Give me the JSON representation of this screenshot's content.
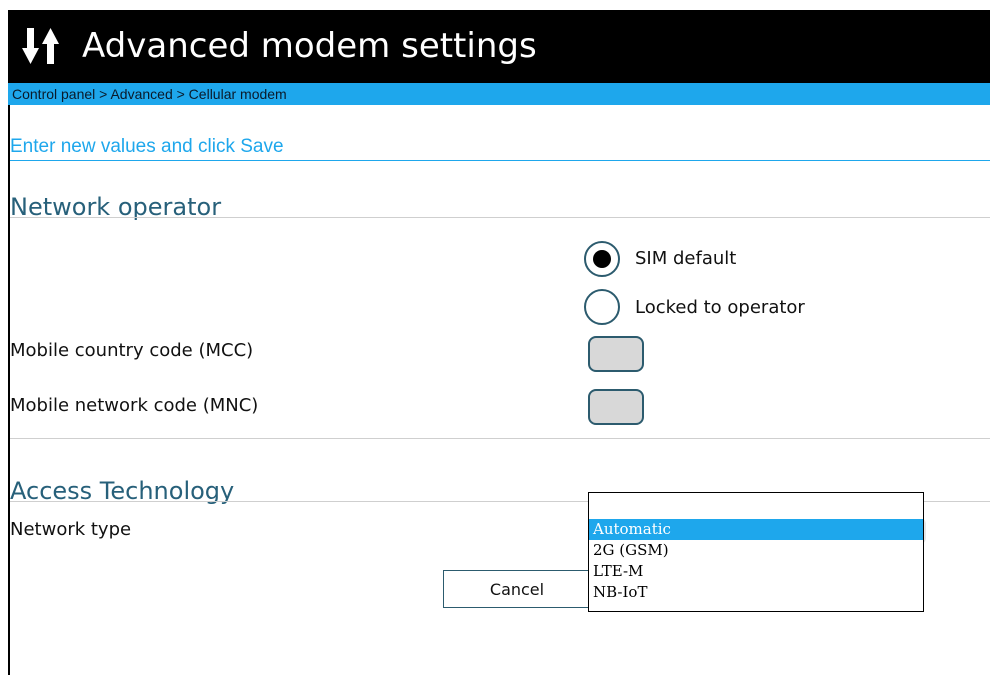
{
  "header": {
    "title": "Advanced modem settings",
    "icon": "up-down-arrows-icon"
  },
  "breadcrumb": {
    "text": "Control panel > Advanced > Cellular modem"
  },
  "instructions": "Enter new values and click Save",
  "network_operator": {
    "title": "Network operator",
    "options": [
      {
        "label": "SIM default",
        "selected": true
      },
      {
        "label": "Locked to operator",
        "selected": false
      }
    ],
    "mcc": {
      "label": "Mobile country code (MCC)",
      "value": ""
    },
    "mnc": {
      "label": "Mobile network code (MNC)",
      "value": ""
    }
  },
  "access_technology": {
    "title": "Access Technology",
    "network_type": {
      "label": "Network type",
      "selected": "Automatic",
      "options": [
        "Automatic",
        "2G (GSM)",
        "LTE-M",
        "NB-IoT"
      ]
    }
  },
  "actions": {
    "cancel_label": "Cancel"
  },
  "colors": {
    "accent": "#1ea7ec",
    "header_bg": "#000000",
    "section_title": "#27607a"
  }
}
